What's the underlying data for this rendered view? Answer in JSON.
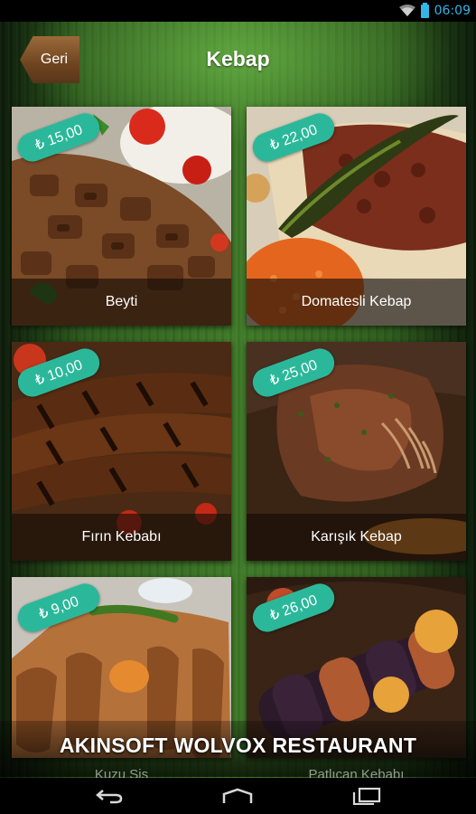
{
  "status_bar": {
    "time": "06:09",
    "icons": [
      "wifi-icon",
      "battery-icon"
    ],
    "accent": "#33b5e5"
  },
  "header": {
    "back_label": "Geri",
    "title": "Kebap"
  },
  "menu": {
    "items": [
      {
        "name": "Beyti",
        "price": "₺ 15,00"
      },
      {
        "name": "Domatesli Kebap",
        "price": "₺ 22,00"
      },
      {
        "name": "Fırın Kebabı",
        "price": "₺ 10,00"
      },
      {
        "name": "Karışık Kebap",
        "price": "₺ 25,00"
      },
      {
        "name": "Kuzu Şiş",
        "price": "₺ 9,00"
      },
      {
        "name": "Patlıcan Kebabı",
        "price": "₺ 26,00"
      }
    ]
  },
  "footer": {
    "title": "AKINSOFT WOLVOX RESTAURANT"
  },
  "nav_bar": {
    "buttons": [
      "back-icon",
      "home-icon",
      "recent-apps-icon"
    ]
  },
  "colors": {
    "price_badge": "#2bb89a",
    "back_button": "#7a4d25",
    "background": "#3f7a28"
  }
}
